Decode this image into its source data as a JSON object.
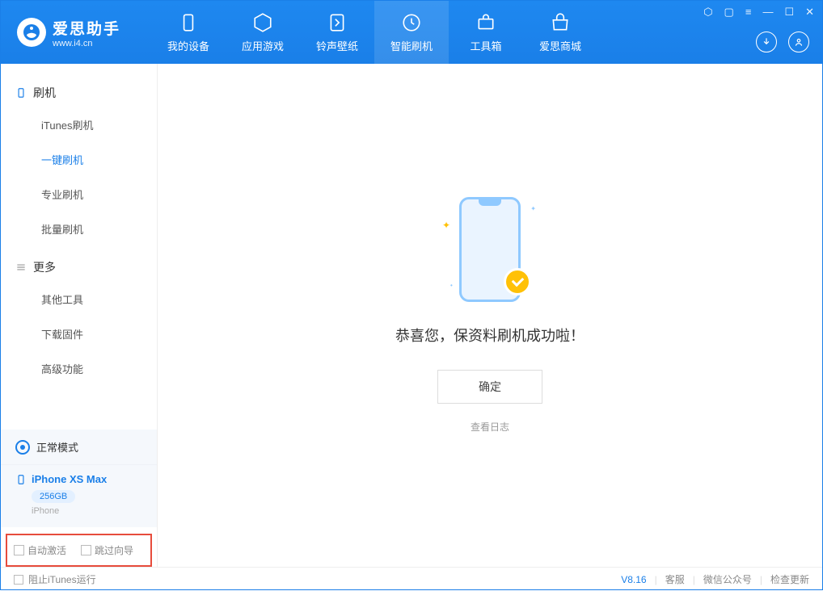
{
  "logo": {
    "title": "爱思助手",
    "sub": "www.i4.cn"
  },
  "nav": {
    "items": [
      {
        "label": "我的设备"
      },
      {
        "label": "应用游戏"
      },
      {
        "label": "铃声壁纸"
      },
      {
        "label": "智能刷机"
      },
      {
        "label": "工具箱"
      },
      {
        "label": "爱思商城"
      }
    ]
  },
  "sidebar": {
    "section1": {
      "title": "刷机",
      "items": [
        "iTunes刷机",
        "一键刷机",
        "专业刷机",
        "批量刷机"
      ]
    },
    "section2": {
      "title": "更多",
      "items": [
        "其他工具",
        "下载固件",
        "高级功能"
      ]
    },
    "mode": "正常模式",
    "device": {
      "name": "iPhone XS Max",
      "capacity": "256GB",
      "type": "iPhone"
    },
    "checks": {
      "auto_activate": "自动激活",
      "skip_guide": "跳过向导"
    }
  },
  "main": {
    "success_text": "恭喜您，保资料刷机成功啦！",
    "ok_btn": "确定",
    "log_link": "查看日志"
  },
  "footer": {
    "block_itunes": "阻止iTunes运行",
    "version": "V8.16",
    "links": [
      "客服",
      "微信公众号",
      "检查更新"
    ]
  }
}
